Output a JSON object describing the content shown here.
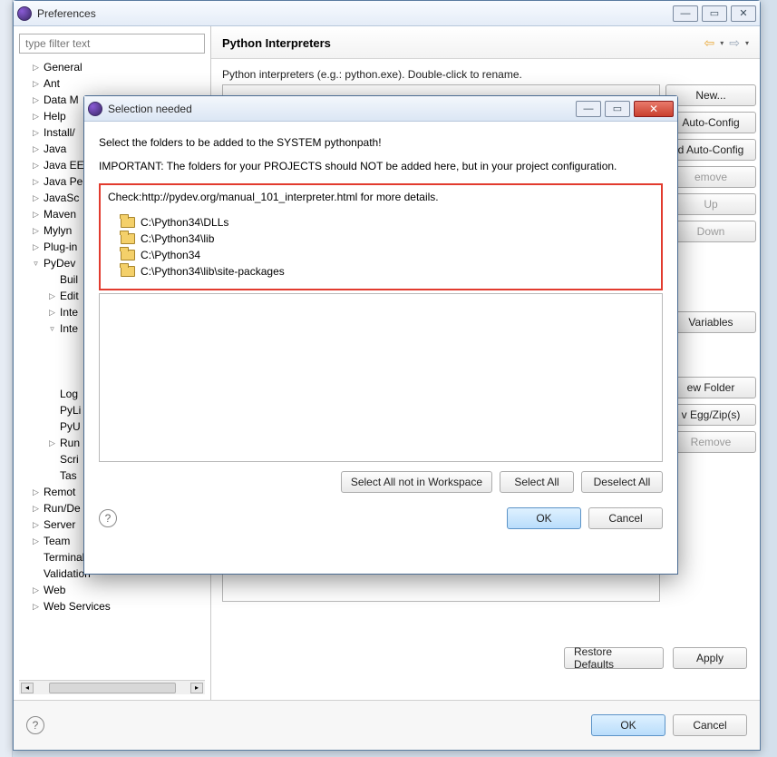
{
  "prefs": {
    "title": "Preferences",
    "filter_placeholder": "type filter text",
    "tree": {
      "general": "General",
      "ant": "Ant",
      "datam": "Data M",
      "help": "Help",
      "install": "Install/",
      "java": "Java",
      "javaee": "Java EE",
      "javape": "Java Pe",
      "javasc": "JavaSc",
      "maven": "Maven",
      "mylyn": "Mylyn",
      "plugin": "Plug-in",
      "pydev": "PyDev",
      "builders": "Buil",
      "editor": "Edit",
      "inter1": "Inte",
      "inter2": "Inte",
      "log": "Log",
      "pyli": "PyLi",
      "pyu": "PyU",
      "run": "Run",
      "scr": "Scri",
      "tas": "Tas",
      "remote": "Remot",
      "rundeb": "Run/De",
      "server": "Server",
      "team": "Team",
      "terminal": "Terminal",
      "validation": "Validation",
      "web": "Web",
      "webservices": "Web Services"
    },
    "right": {
      "heading": "Python Interpreters",
      "hint": "Python interpreters (e.g.: python.exe).   Double-click to rename.",
      "buttons": {
        "new": "New...",
        "autoconfig": "Auto-Config",
        "advautoconfig": "d Auto-Config",
        "remove": "emove",
        "up": "Up",
        "down": "Down",
        "vars": "Variables",
        "newfolder": "ew Folder",
        "eggzip": "v Egg/Zip(s)",
        "remove3": "Remove"
      },
      "restore": "Restore Defaults",
      "apply": "Apply"
    },
    "footer": {
      "ok": "OK",
      "cancel": "Cancel"
    }
  },
  "modal": {
    "title": "Selection needed",
    "line1": "Select the folders to be added to the SYSTEM pythonpath!",
    "line2": "IMPORTANT: The folders for your PROJECTS should NOT be added here, but in your project configuration.",
    "check": "Check:http://pydev.org/manual_101_interpreter.html for more details.",
    "items": {
      "a": "C:\\Python34\\DLLs",
      "b": "C:\\Python34\\lib",
      "c": "C:\\Python34",
      "d": "C:\\Python34\\lib\\site-packages"
    },
    "actions": {
      "selnotws": "Select All not in Workspace",
      "selall": "Select All",
      "deselall": "Deselect All",
      "ok": "OK",
      "cancel": "Cancel"
    }
  }
}
